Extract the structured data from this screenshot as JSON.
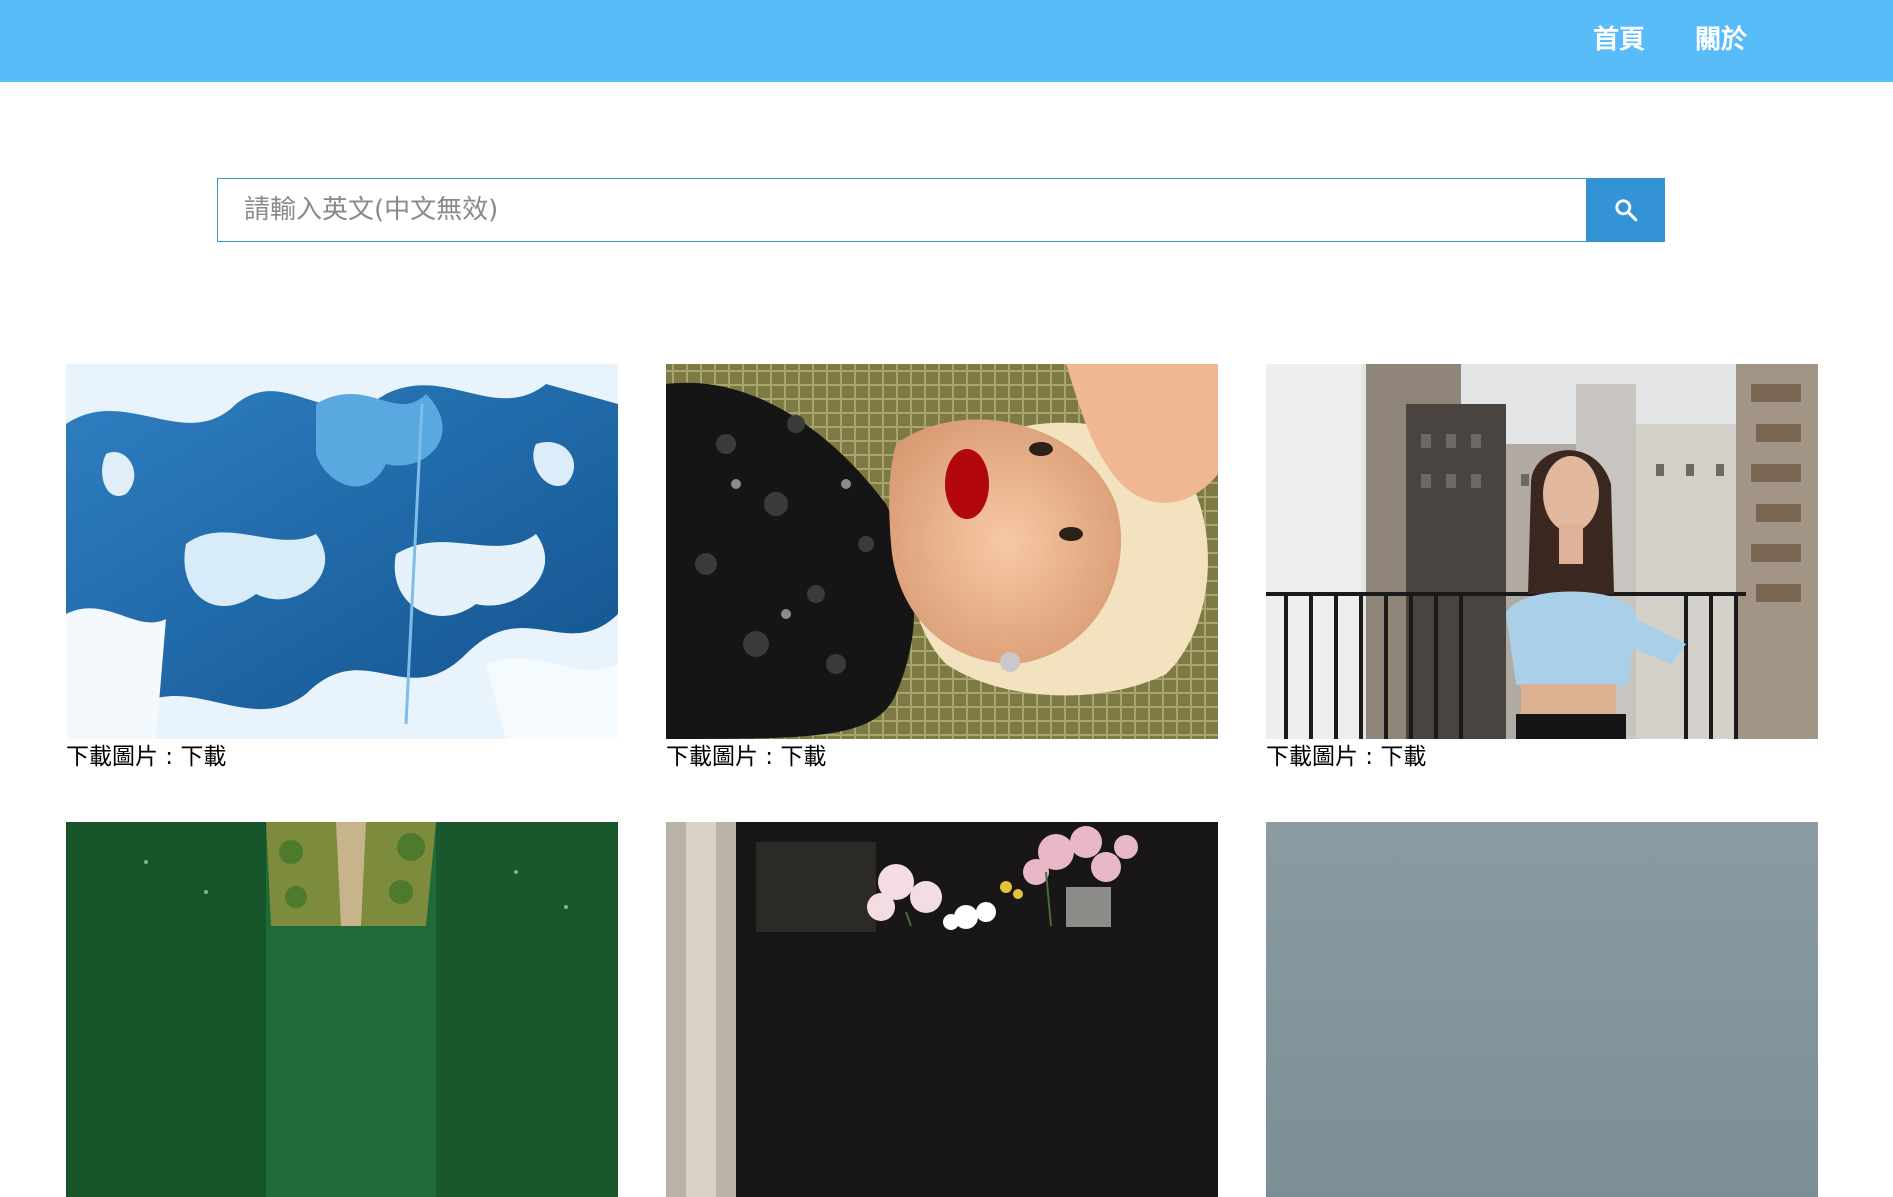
{
  "nav": {
    "home_label": "首頁",
    "about_label": "關於"
  },
  "search": {
    "placeholder": "請輸入英文(中文無效)",
    "value": "",
    "button_icon": "search-icon"
  },
  "gallery": {
    "cards": [
      {
        "subject": "blue-white-cyanotype-abstract",
        "caption_prefix": "下載圖片 : ",
        "caption_link": "下載"
      },
      {
        "subject": "blonde-woman-red-lips-lying-sequins",
        "caption_prefix": "下載圖片 : ",
        "caption_link": "下載"
      },
      {
        "subject": "woman-blue-corset-balcony-city",
        "caption_prefix": "下載圖片 : ",
        "caption_link": "下載"
      },
      {
        "subject": "aerial-green-water-island"
      },
      {
        "subject": "flower-shop-pink-peonies"
      },
      {
        "subject": "grey-misty-sky"
      }
    ]
  },
  "colors": {
    "header_bg": "#58bcf8",
    "search_button_bg": "#3393d6",
    "search_border": "#3a96cf"
  }
}
